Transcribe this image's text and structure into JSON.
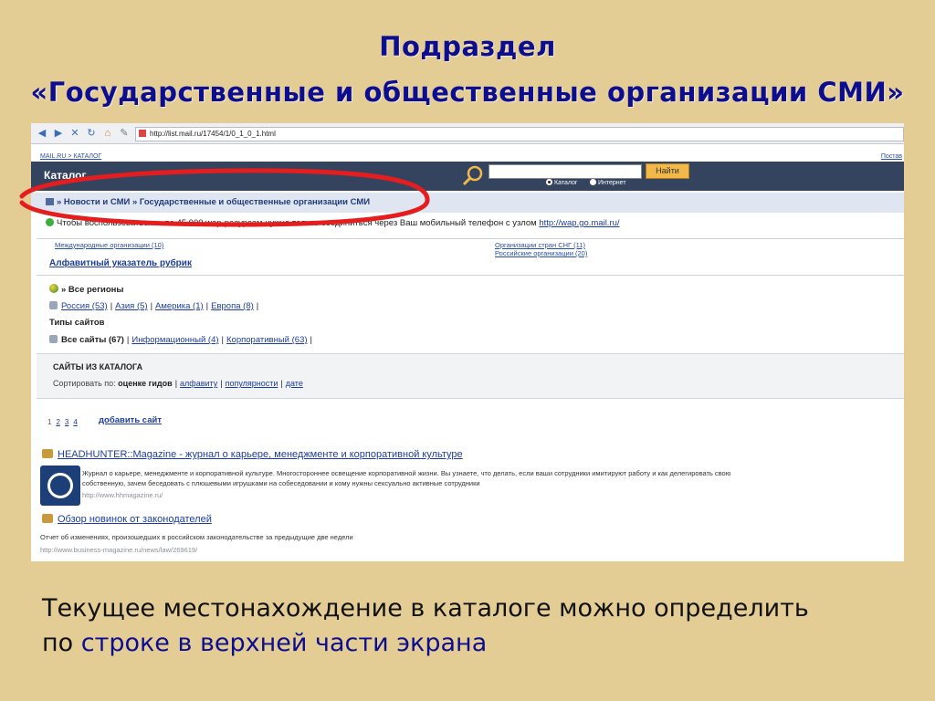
{
  "slide": {
    "title_line1": "Подраздел",
    "title_line2": "«Государственные и общественные организации СМИ»",
    "caption_line1": "Текущее местонахождение в каталоге можно определить",
    "caption_line2_prefix": "по ",
    "caption_line2_highlight": "строке в верхней части экрана"
  },
  "browser": {
    "address": "http://list.mail.ru/17454/1/0_1_0_1.html",
    "toolbar_icons": [
      "back-icon",
      "forward-icon",
      "stop-icon",
      "refresh-icon",
      "home-icon",
      "history-icon",
      "edit-icon"
    ]
  },
  "site": {
    "top_breadcrumb": "MAIL.RU > КАТАЛОГ",
    "top_right": "Постав",
    "logo": "Каталог",
    "search_button": "Найти",
    "radio_catalog": "Каталог",
    "radio_internet": "Интернет",
    "breadcrumb": "» Новости и СМИ » Государственные и общественные организации СМИ",
    "promo_text": "Чтобы воспользоваться ... по 45 000 wap-ресурсам нужно только соединиться через Ваш мобильный телефон с узлом ",
    "promo_link": "http://wap.go.mail.ru/",
    "subcats": {
      "left1": "Международные организации (10)",
      "right1": "Организации стран СНГ (11)",
      "right2": "Российские организации (20)"
    },
    "alpha_index": "Алфавитный указатель рубрик",
    "regions_header": "» Все регионы",
    "regions": [
      "Россия (53)",
      "Азия (5)",
      "Америка (1)",
      "Европа (8)"
    ],
    "site_types_label": "Типы сайтов",
    "site_types_all": "Все сайты (67)",
    "site_types": [
      "Информационный (4)",
      "Корпоративный (63)"
    ],
    "catalog_sites_label": "САЙТЫ ИЗ КАТАЛОГА",
    "sort_label": "Сортировать по:",
    "sort_current": "оценке гидов",
    "sort_options": [
      "алфавиту",
      "популярности",
      "дате"
    ],
    "pages": [
      "1",
      "2",
      "3",
      "4"
    ],
    "add_site": "добавить сайт",
    "results": [
      {
        "title": "HEADHUNTER::Magazine - журнал о карьере, менеджменте и корпоративной культуре",
        "desc1": "Журнал о карьере, менеджменте и корпоративной культуре. Многостороннее освещение корпоративной жизни. Вы узнаете, что делать, если ваши сотрудники имитируют работу и как делегировать свою",
        "desc2": "собственную, зачем беседовать с плюшевыми игрушками на собеседовании и кому нужны сексуально активные сотрудники",
        "url": "http://www.hhmagazine.ru/"
      },
      {
        "title": "Обзор новинок от законодателей",
        "desc1": "Отчет об изменениях, произошедших в российском законодательстве за предыдущие две недели",
        "url": "http://www.business-magazine.ru/news/law/269619/"
      }
    ]
  },
  "colors": {
    "slide_bg": "#e3cd94",
    "title_blue": "#0d0d8f",
    "header_navy": "#34435e",
    "button_orange": "#f2b94a",
    "annotation_red": "#e41e1e"
  }
}
